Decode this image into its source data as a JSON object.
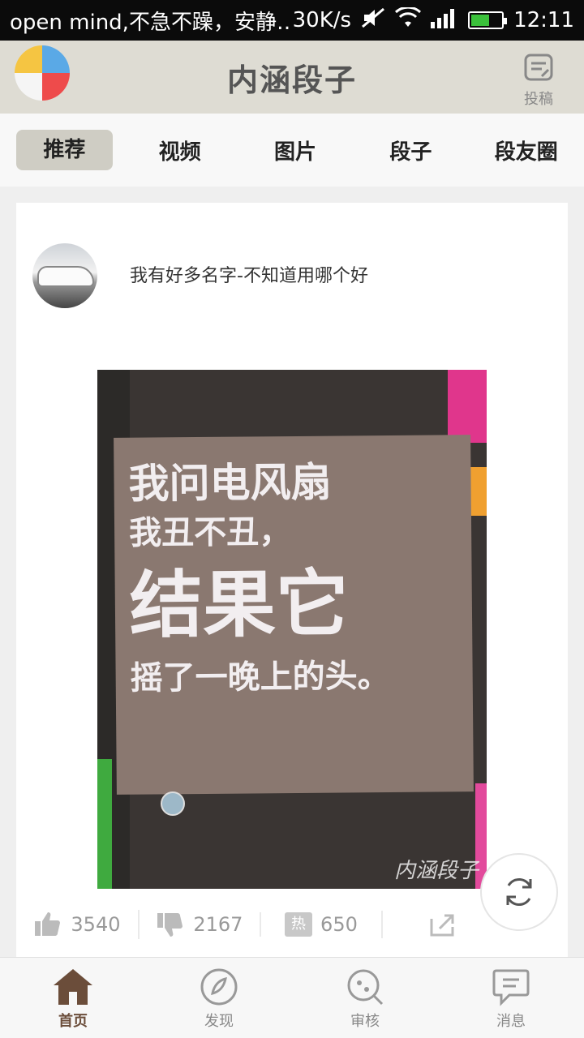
{
  "status_bar": {
    "notification": "open mind,不急不躁，安静…",
    "speed": "30K/s",
    "time": "12:11"
  },
  "app_bar": {
    "title": "内涵段子",
    "submit_label": "投稿"
  },
  "tabs": [
    {
      "label": "推荐",
      "active": true
    },
    {
      "label": "视频",
      "active": false
    },
    {
      "label": "图片",
      "active": false
    },
    {
      "label": "段子",
      "active": false
    },
    {
      "label": "段友圈",
      "active": false
    }
  ],
  "post": {
    "username": "我有好多名字-不知道用哪个好",
    "image_text": {
      "line1": "我问电风扇",
      "line2": "我丑不丑，",
      "line3": "结果它",
      "line4": "摇了一晚上的头。",
      "watermark": "内涵段子"
    },
    "likes": "3540",
    "dislikes": "2167",
    "hot_badge": "热",
    "comments": "650"
  },
  "bottom_nav": [
    {
      "label": "首页",
      "icon": "home-icon",
      "active": true
    },
    {
      "label": "发现",
      "icon": "compass-icon",
      "active": false
    },
    {
      "label": "审核",
      "icon": "review-icon",
      "active": false
    },
    {
      "label": "消息",
      "icon": "message-icon",
      "active": false
    }
  ],
  "colors": {
    "appbar_bg": "#dedcd3",
    "accent": "#6b4d3a",
    "tab_active_bg": "#cfcdc4"
  }
}
